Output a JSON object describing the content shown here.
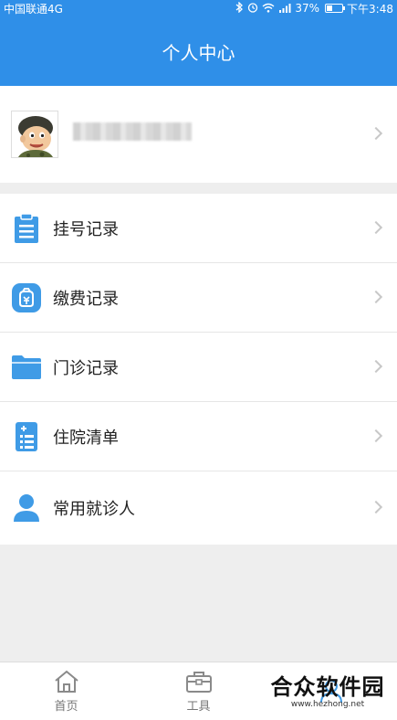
{
  "status_bar": {
    "carrier": "中国联通4G",
    "battery_percent": "37%",
    "battery_level": 0.37,
    "time": "下午3:48",
    "icons": [
      "bluetooth-icon",
      "alarm-icon",
      "wifi-icon",
      "signal-icon",
      "battery-icon"
    ]
  },
  "header": {
    "title": "个人中心"
  },
  "profile": {
    "avatar_icon": "avatar-cartoon-soldier"
  },
  "menu": {
    "items": [
      {
        "label": "挂号记录",
        "icon": "clipboard-icon"
      },
      {
        "label": "缴费记录",
        "icon": "wallet-icon"
      },
      {
        "label": "门诊记录",
        "icon": "folder-icon"
      },
      {
        "label": "住院清单",
        "icon": "list-icon"
      },
      {
        "label": "常用就诊人",
        "icon": "person-icon"
      }
    ]
  },
  "tabbar": {
    "tabs": [
      {
        "label": "首页",
        "icon": "home-icon"
      },
      {
        "label": "工具",
        "icon": "toolbox-icon"
      },
      {
        "label": "",
        "icon": "user-icon"
      }
    ]
  },
  "watermark": {
    "title": "合众软件园",
    "subtitle": "www.hezhong.net"
  },
  "colors": {
    "primary": "#2f8fe8",
    "icon_blue": "#3f9be6",
    "background": "#eeeeee"
  }
}
